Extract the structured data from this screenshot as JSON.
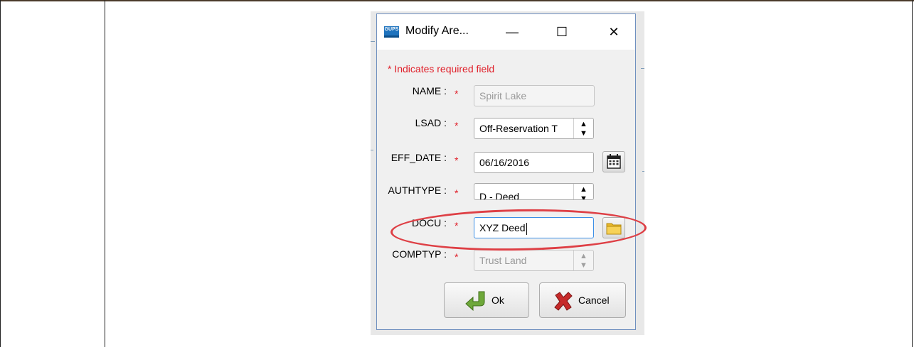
{
  "dialog": {
    "title": "Modify Are...",
    "app_icon_text": "GUPS",
    "controls": {
      "minimize": "—",
      "maximize": "☐",
      "close": "✕"
    },
    "required_note": "* Indicates required field",
    "required_marker": "*",
    "fields": {
      "name": {
        "label": "NAME :",
        "value": "Spirit Lake",
        "enabled": false
      },
      "lsad": {
        "label": "LSAD :",
        "value": "Off-Reservation T",
        "arrows": "▲▼"
      },
      "eff_date": {
        "label": "EFF_DATE :",
        "value": "06/16/2016"
      },
      "authtype": {
        "label": "AUTHTYPE :",
        "value": "D - Deed",
        "arrows": "▲▼"
      },
      "docu": {
        "label": "DOCU :",
        "value": "XYZ Deed"
      },
      "comptyp": {
        "label": "COMPTYP :",
        "value": "Trust Land",
        "arrows": "▲▼",
        "enabled": false
      }
    },
    "buttons": {
      "ok": "Ok",
      "cancel": "Cancel"
    }
  },
  "icons": [
    "app-icon",
    "calendar-icon",
    "folder-icon",
    "ok-arrow-icon",
    "cancel-x-icon"
  ],
  "colors": {
    "required": "#e0202a",
    "highlight_ellipse": "#de3f45",
    "window_border": "#6e8fbf"
  }
}
